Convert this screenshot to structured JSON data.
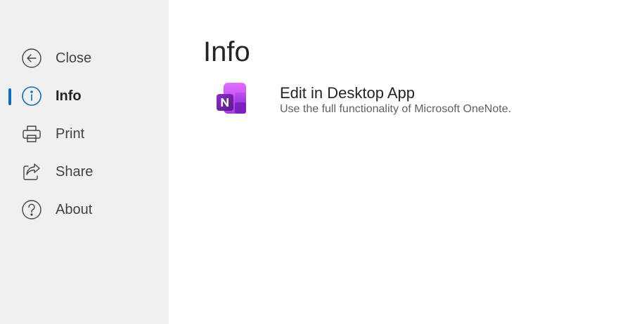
{
  "colors": {
    "sidebar_bg": "#f0f0f0",
    "accent": "#0f6cbd",
    "onenote_purple": "#7719aa"
  },
  "sidebar": {
    "items": [
      {
        "label": "Close",
        "icon": "back-arrow-icon",
        "active": false
      },
      {
        "label": "Info",
        "icon": "info-icon",
        "active": true
      },
      {
        "label": "Print",
        "icon": "printer-icon",
        "active": false
      },
      {
        "label": "Share",
        "icon": "share-icon",
        "active": false
      },
      {
        "label": "About",
        "icon": "help-icon",
        "active": false
      }
    ]
  },
  "main": {
    "title": "Info",
    "actions": [
      {
        "title": "Edit in Desktop App",
        "description": "Use the full functionality of Microsoft OneNote.",
        "icon": "onenote-app-icon"
      }
    ]
  }
}
